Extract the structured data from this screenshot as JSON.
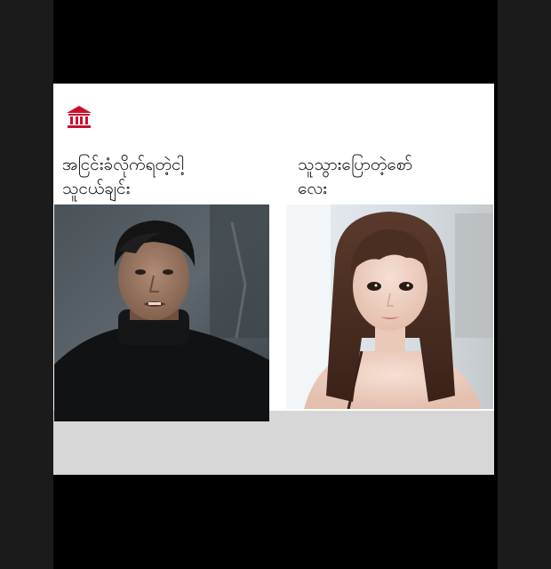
{
  "header": {
    "icon": "bank-icon",
    "accent": "#c8102e"
  },
  "captions": {
    "left": [
      "အငြင်းခံလိုက်ရတဲ့ငါ့",
      "သူငယ်ချင်း"
    ],
    "right": [
      "သူသွားပြောတဲ့စော်",
      "လေး"
    ]
  },
  "photos": {
    "left": "photo-young-man",
    "right": "photo-young-woman"
  },
  "colors": {
    "background": "#000000",
    "side_band": "#1b1b1b",
    "card": "#ffffff",
    "card_base": "#d7d7d7"
  }
}
